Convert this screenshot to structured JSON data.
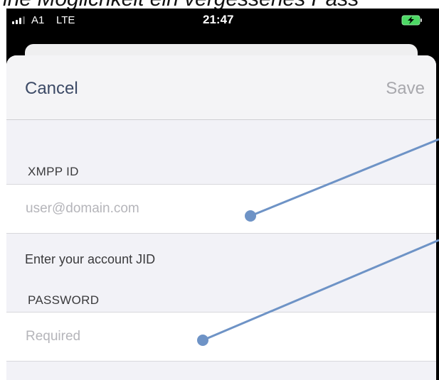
{
  "caption": {
    "text": "ine Möglichkeit ein vergessenes Pass"
  },
  "status_bar": {
    "carrier": "A1",
    "network": "LTE",
    "time": "21:47",
    "signal_icon": "signal-bars-icon",
    "battery_icon": "battery-charging-icon"
  },
  "nav": {
    "cancel_label": "Cancel",
    "save_label": "Save"
  },
  "form": {
    "xmpp_section": {
      "header": "XMPP ID",
      "placeholder": "user@domain.com",
      "value": "",
      "footer": "Enter your account JID"
    },
    "password_section": {
      "header": "PASSWORD",
      "placeholder": "Required",
      "value": ""
    }
  },
  "colors": {
    "accent": "#3c4a66",
    "annotation": "#6e93c6",
    "disabled": "#a8a8ad",
    "sheet_bg": "#f2f2f7"
  }
}
